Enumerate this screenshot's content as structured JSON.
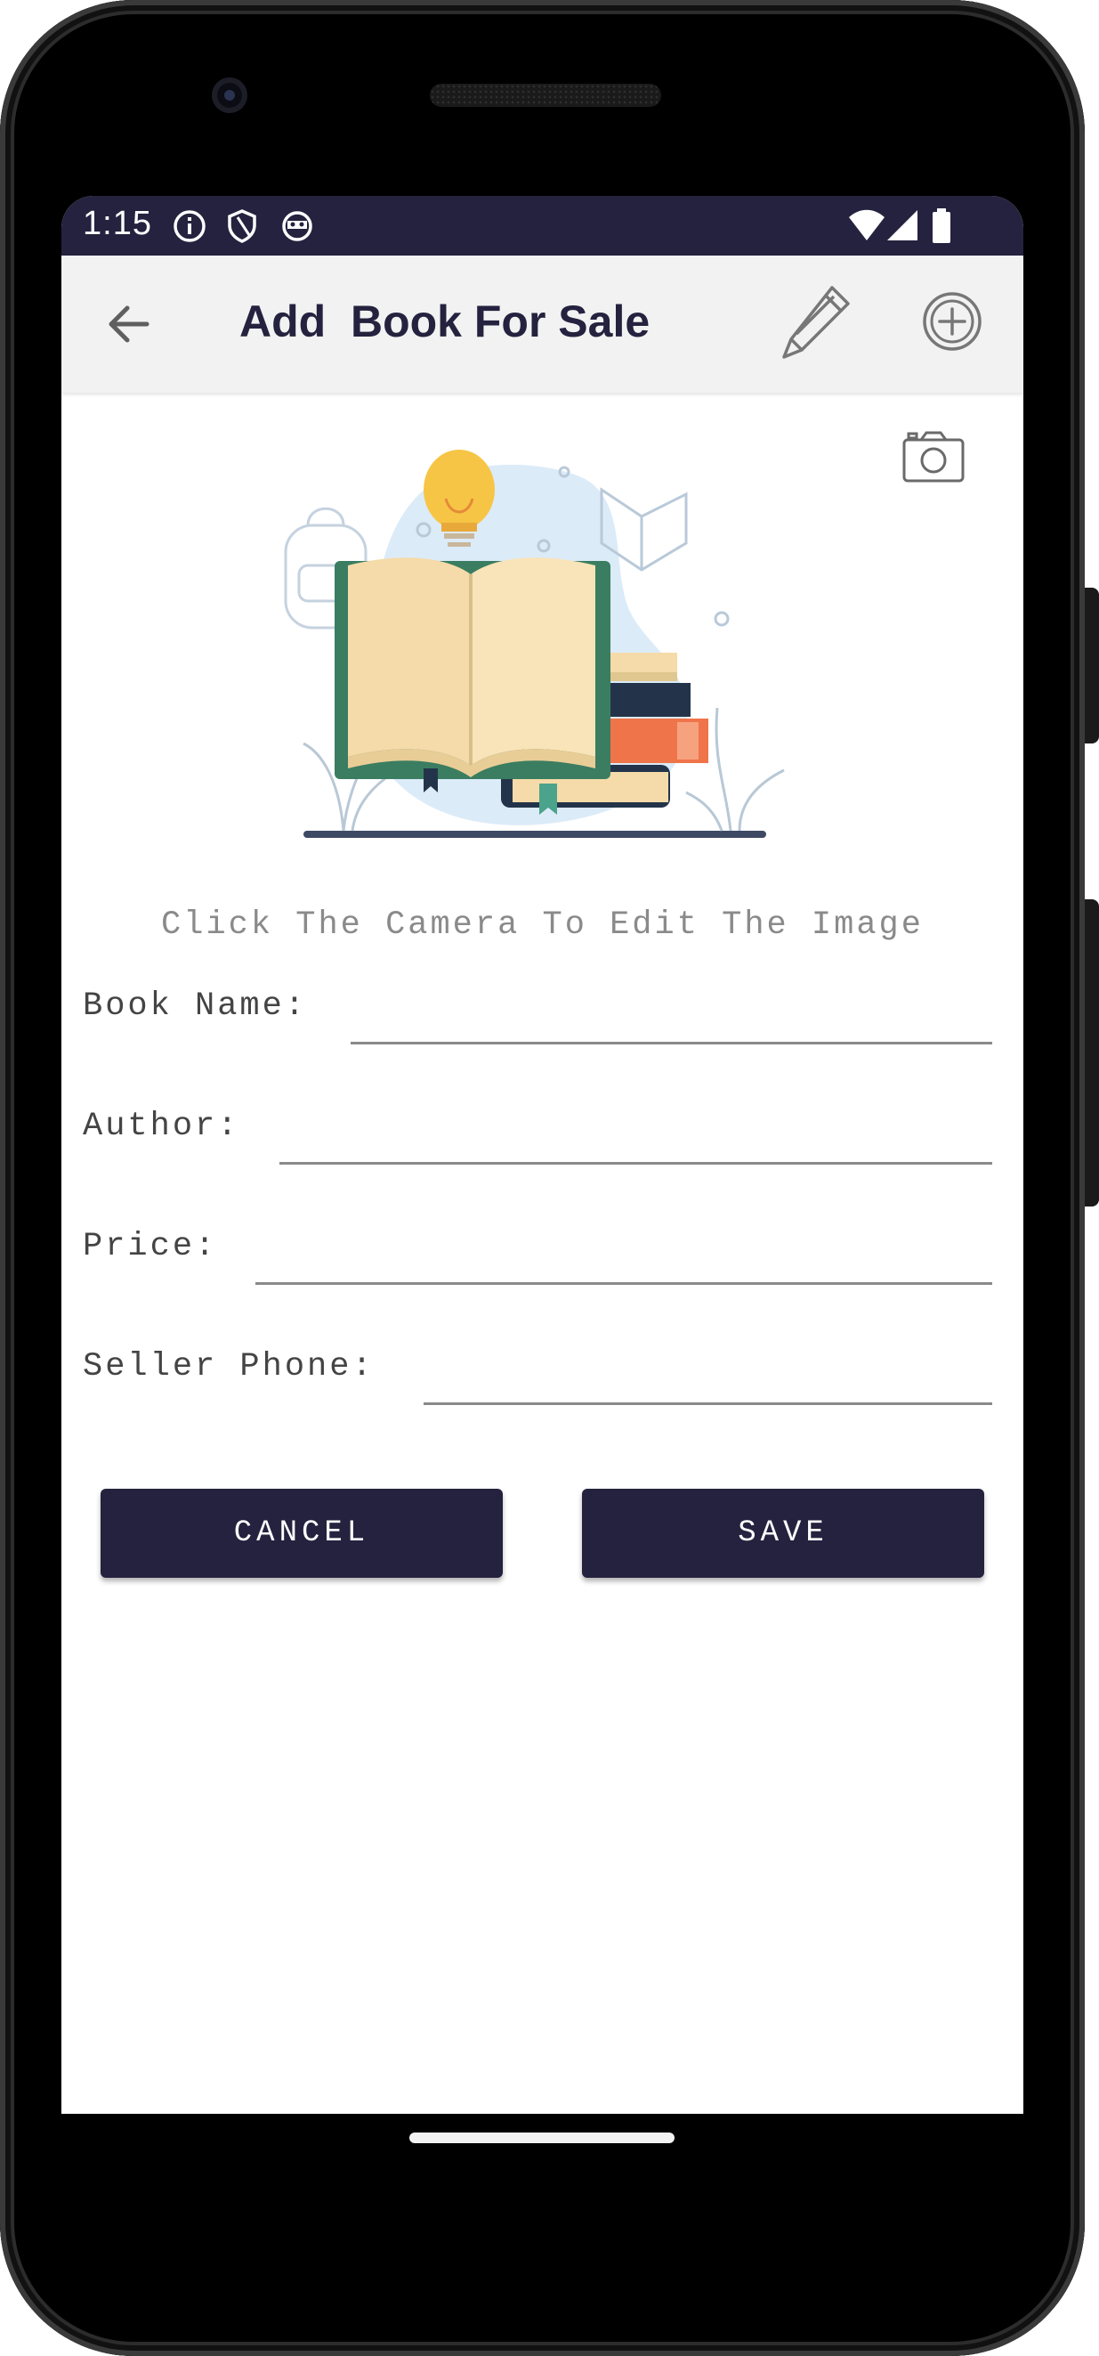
{
  "status_bar": {
    "time": "1:15",
    "icons_left": [
      "info-icon",
      "shield-icon",
      "app-notification-icon"
    ],
    "icons_right": [
      "wifi-icon",
      "cellular-signal-icon",
      "battery-icon"
    ]
  },
  "toolbar": {
    "title": "Add  Book For Sale",
    "back_icon": "arrow-back-icon",
    "edit_icon": "pencil-icon",
    "add_icon": "plus-circle-icon"
  },
  "image_section": {
    "camera_icon": "camera-icon",
    "illustration": "books-illustration",
    "hint": "Click The Camera To Edit The Image"
  },
  "form": {
    "book_name": {
      "label": "Book Name:",
      "value": ""
    },
    "author": {
      "label": "Author:",
      "value": ""
    },
    "price": {
      "label": "Price:",
      "value": ""
    },
    "seller_phone": {
      "label": "Seller Phone:",
      "value": ""
    }
  },
  "actions": {
    "cancel_label": "CANCEL",
    "save_label": "SAVE"
  },
  "colors": {
    "primary": "#25223f",
    "toolbar_bg": "#f2f2f2",
    "hint_text": "#8a8a8a"
  }
}
